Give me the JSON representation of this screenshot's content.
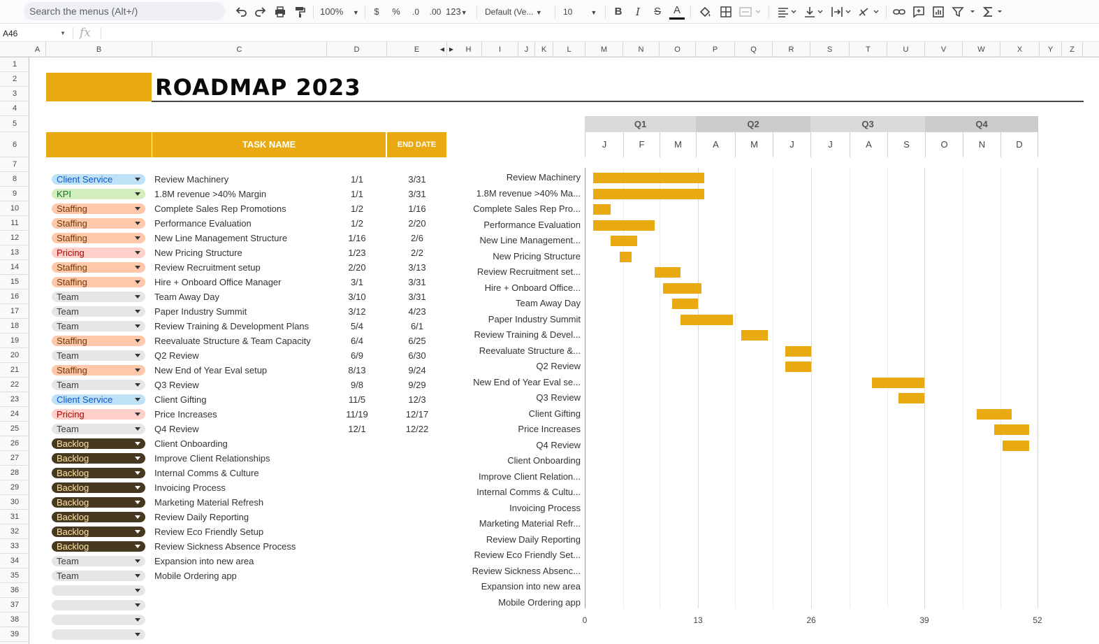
{
  "toolbar": {
    "search_placeholder": "Search the menus (Alt+/)",
    "zoom": "100%",
    "currency": "$",
    "percent": "%",
    "decimal_decrease": ".0",
    "decimal_increase": ".00",
    "more_formats": "123",
    "font": "Default (Ve...",
    "font_size": "10"
  },
  "formula_bar": {
    "cell_ref": "A46",
    "fx": "fx"
  },
  "columns": [
    "A",
    "B",
    "C",
    "D",
    "E",
    "H",
    "I",
    "J",
    "K",
    "L",
    "M",
    "N",
    "O",
    "P",
    "Q",
    "R",
    "S",
    "T",
    "U",
    "V",
    "W",
    "X",
    "Y",
    "Z"
  ],
  "rows": [
    "1",
    "2",
    "3",
    "4",
    "5",
    "6",
    "7",
    "8",
    "9",
    "10",
    "11",
    "12",
    "13",
    "14",
    "15",
    "16",
    "17",
    "18",
    "19",
    "20",
    "21",
    "22",
    "23",
    "24",
    "25",
    "26",
    "27",
    "28",
    "29",
    "30",
    "31",
    "32",
    "33",
    "34",
    "35",
    "36",
    "37",
    "38",
    "39"
  ],
  "sheet": {
    "title": "ROADMAP 2023",
    "task_header": "TASK NAME",
    "end_header": "END DATE"
  },
  "tasks": [
    {
      "cat": "Client Service",
      "name": "Review Machinery",
      "start": "1/1",
      "end": "3/31",
      "bg": "#bfe1f6",
      "fg": "#0b57d0"
    },
    {
      "cat": "KPI",
      "name": "1.8M revenue >40% Margin",
      "start": "1/1",
      "end": "3/31",
      "bg": "#d4edbc",
      "fg": "#137333"
    },
    {
      "cat": "Staffing",
      "name": "Complete Sales Rep Promotions",
      "start": "1/2",
      "end": "1/16",
      "bg": "#ffc8aa",
      "fg": "#753800"
    },
    {
      "cat": "Staffing",
      "name": "Performance Evaluation",
      "start": "1/2",
      "end": "2/20",
      "bg": "#ffc8aa",
      "fg": "#753800"
    },
    {
      "cat": "Staffing",
      "name": "New Line Management Structure",
      "start": "1/16",
      "end": "2/6",
      "bg": "#ffc8aa",
      "fg": "#753800"
    },
    {
      "cat": "Pricing",
      "name": "New Pricing Structure",
      "start": "1/23",
      "end": "2/2",
      "bg": "#ffcfc9",
      "fg": "#b10202"
    },
    {
      "cat": "Staffing",
      "name": "Review Recruitment setup",
      "start": "2/20",
      "end": "3/13",
      "bg": "#ffc8aa",
      "fg": "#753800"
    },
    {
      "cat": "Staffing",
      "name": "Hire + Onboard Office Manager",
      "start": "3/1",
      "end": "3/31",
      "bg": "#ffc8aa",
      "fg": "#753800"
    },
    {
      "cat": "Team",
      "name": "Team Away Day",
      "start": "3/10",
      "end": "3/31",
      "bg": "#e6e6e6",
      "fg": "#3d3d3d"
    },
    {
      "cat": "Team",
      "name": "Paper Industry Summit",
      "start": "3/12",
      "end": "4/23",
      "bg": "#e6e6e6",
      "fg": "#3d3d3d"
    },
    {
      "cat": "Team",
      "name": "Review Training & Development Plans",
      "start": "5/4",
      "end": "6/1",
      "bg": "#e6e6e6",
      "fg": "#3d3d3d"
    },
    {
      "cat": "Staffing",
      "name": "Reevaluate Structure & Team Capacity",
      "start": "6/4",
      "end": "6/25",
      "bg": "#ffc8aa",
      "fg": "#753800"
    },
    {
      "cat": "Team",
      "name": "Q2 Review",
      "start": "6/9",
      "end": "6/30",
      "bg": "#e6e6e6",
      "fg": "#3d3d3d"
    },
    {
      "cat": "Staffing",
      "name": "New End of Year Eval setup",
      "start": "8/13",
      "end": "9/24",
      "bg": "#ffc8aa",
      "fg": "#753800"
    },
    {
      "cat": "Team",
      "name": "Q3 Review",
      "start": "9/8",
      "end": "9/29",
      "bg": "#e6e6e6",
      "fg": "#3d3d3d"
    },
    {
      "cat": "Client Service",
      "name": "Client Gifting",
      "start": "11/5",
      "end": "12/3",
      "bg": "#bfe1f6",
      "fg": "#0b57d0"
    },
    {
      "cat": "Pricing",
      "name": "Price Increases",
      "start": "11/19",
      "end": "12/17",
      "bg": "#ffcfc9",
      "fg": "#b10202"
    },
    {
      "cat": "Team",
      "name": "Q4 Review",
      "start": "12/1",
      "end": "12/22",
      "bg": "#e6e6e6",
      "fg": "#3d3d3d"
    },
    {
      "cat": "Backlog",
      "name": "Client Onboarding",
      "start": "",
      "end": "",
      "bg": "#473821",
      "fg": "#ffe5a0"
    },
    {
      "cat": "Backlog",
      "name": "Improve Client Relationships",
      "start": "",
      "end": "",
      "bg": "#473821",
      "fg": "#ffe5a0"
    },
    {
      "cat": "Backlog",
      "name": "Internal Comms & Culture",
      "start": "",
      "end": "",
      "bg": "#473821",
      "fg": "#ffe5a0"
    },
    {
      "cat": "Backlog",
      "name": "Invoicing Process",
      "start": "",
      "end": "",
      "bg": "#473821",
      "fg": "#ffe5a0"
    },
    {
      "cat": "Backlog",
      "name": "Marketing Material Refresh",
      "start": "",
      "end": "",
      "bg": "#473821",
      "fg": "#ffe5a0"
    },
    {
      "cat": "Backlog",
      "name": "Review Daily Reporting",
      "start": "",
      "end": "",
      "bg": "#473821",
      "fg": "#ffe5a0"
    },
    {
      "cat": "Backlog",
      "name": "Review Eco Friendly Setup",
      "start": "",
      "end": "",
      "bg": "#473821",
      "fg": "#ffe5a0"
    },
    {
      "cat": "Backlog",
      "name": "Review Sickness Absence Process",
      "start": "",
      "end": "",
      "bg": "#473821",
      "fg": "#ffe5a0"
    },
    {
      "cat": "Team",
      "name": "Expansion into new area",
      "start": "",
      "end": "",
      "bg": "#e6e6e6",
      "fg": "#3d3d3d"
    },
    {
      "cat": "Team",
      "name": "Mobile Ordering app",
      "start": "",
      "end": "",
      "bg": "#e6e6e6",
      "fg": "#3d3d3d"
    },
    {
      "cat": "",
      "name": "",
      "start": "",
      "end": "",
      "bg": "#e6e6e6",
      "fg": "#3d3d3d"
    },
    {
      "cat": "",
      "name": "",
      "start": "",
      "end": "",
      "bg": "#e6e6e6",
      "fg": "#3d3d3d"
    },
    {
      "cat": "",
      "name": "",
      "start": "",
      "end": "",
      "bg": "#e6e6e6",
      "fg": "#3d3d3d"
    },
    {
      "cat": "",
      "name": "",
      "start": "",
      "end": "",
      "bg": "#e6e6e6",
      "fg": "#3d3d3d"
    }
  ],
  "chart_data": {
    "type": "bar",
    "orientation": "horizontal-gantt",
    "quarters": [
      "Q1",
      "Q2",
      "Q3",
      "Q4"
    ],
    "months": [
      "J",
      "F",
      "M",
      "A",
      "M",
      "J",
      "J",
      "A",
      "S",
      "O",
      "N",
      "D"
    ],
    "categories": [
      "Review Machinery",
      "1.8M revenue >40% Ma...",
      "Complete Sales Rep Pro...",
      "Performance Evaluation",
      "New Line Management...",
      "New Pricing Structure",
      "Review Recruitment set...",
      "Hire + Onboard Office...",
      "Team Away Day",
      "Paper Industry Summit",
      "Review Training & Devel...",
      "Reevaluate Structure &...",
      "Q2 Review",
      "New End of Year Eval se...",
      "Q3 Review",
      "Client Gifting",
      "Price Increases",
      "Q4 Review",
      "Client Onboarding",
      "Improve Client Relation...",
      "Internal Comms & Cultu...",
      "Invoicing Process",
      "Marketing Material Refr...",
      "Review Daily Reporting",
      "Review Eco Friendly Set...",
      "Review Sickness Absenc...",
      "Expansion into new area",
      "Mobile Ordering app"
    ],
    "start_week": [
      1,
      1,
      1,
      1,
      3,
      4,
      8,
      9,
      10,
      11,
      18,
      23,
      23,
      33,
      36,
      45,
      47,
      48,
      null,
      null,
      null,
      null,
      null,
      null,
      null,
      null,
      null,
      null
    ],
    "end_week": [
      13.7,
      13.7,
      3,
      8,
      6,
      5.4,
      11,
      13.4,
      13,
      17,
      21,
      26,
      26,
      39,
      39,
      49,
      51,
      51,
      null,
      null,
      null,
      null,
      null,
      null,
      null,
      null,
      null,
      null
    ],
    "xlim": [
      0,
      52
    ],
    "xticks": [
      "0",
      "13",
      "26",
      "39",
      "52"
    ],
    "bar_color": "#e8a911"
  }
}
